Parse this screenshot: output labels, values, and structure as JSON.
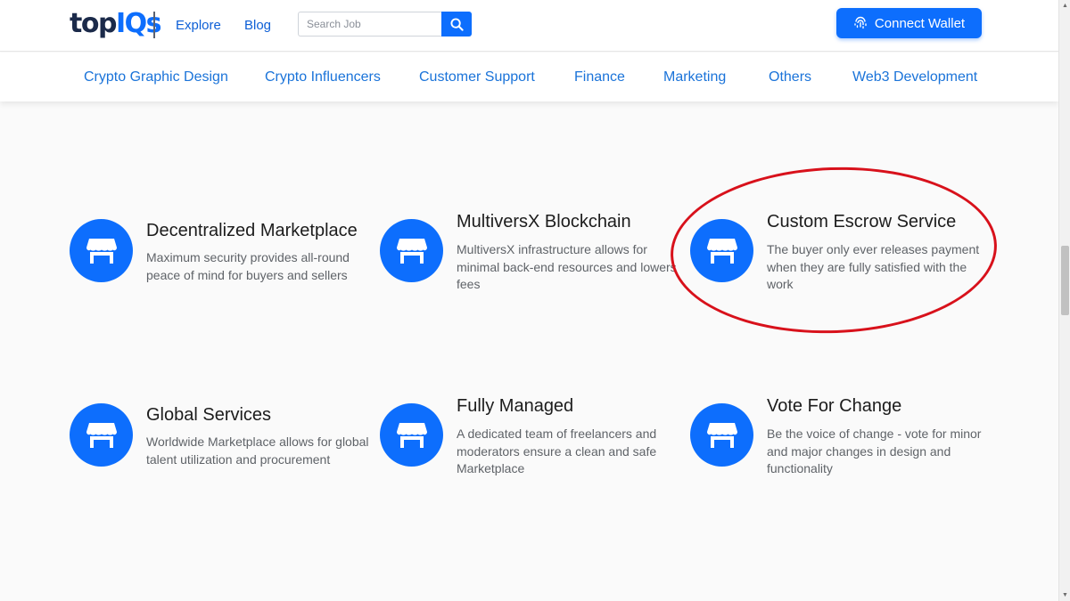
{
  "header": {
    "logo_part1": "top",
    "logo_part2": "IQs",
    "nav": {
      "explore": "Explore",
      "blog": "Blog"
    },
    "search": {
      "placeholder": "Search Job",
      "icon": "search-icon"
    },
    "wallet_button": {
      "label": "Connect Wallet",
      "icon": "fingerprint-icon"
    }
  },
  "categories": [
    "Crypto Graphic Design",
    "Crypto Influencers",
    "Customer Support",
    "Finance",
    "Marketing",
    "Others",
    "Web3 Development"
  ],
  "features": [
    {
      "title": "Decentralized Marketplace",
      "description": "Maximum security provides all-round peace of mind for buyers and sellers",
      "icon": "store-icon"
    },
    {
      "title": "MultiversX Blockchain",
      "description": "MultiversX infrastructure allows for minimal back-end resources and lowers fees",
      "icon": "store-icon"
    },
    {
      "title": "Custom Escrow Service",
      "description": "The buyer only ever releases payment when they are fully satisfied with the work",
      "icon": "store-icon"
    },
    {
      "title": "Global Services",
      "description": "Worldwide Marketplace allows for global talent utilization and procurement",
      "icon": "store-icon"
    },
    {
      "title": "Fully Managed",
      "description": "A dedicated team of freelancers and moderators ensure a clean and safe Marketplace",
      "icon": "store-icon"
    },
    {
      "title": "Vote For Change",
      "description": "Be the voice of change - vote for minor and major changes in design and functionality",
      "icon": "store-icon"
    }
  ],
  "colors": {
    "primary": "#0d6efd",
    "link": "#1a73d9",
    "annotation": "#d8111b"
  }
}
